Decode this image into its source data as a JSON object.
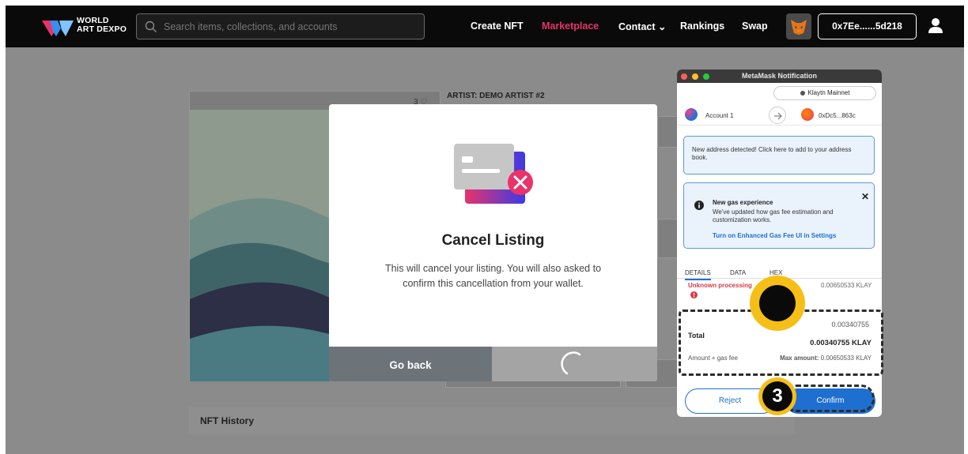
{
  "header": {
    "brand_line1": "WORLD",
    "brand_line2": "ART DEXPO",
    "search_placeholder": "Search items, collections, and accounts",
    "nav": {
      "create": "Create NFT",
      "marketplace": "Marketplace",
      "contact": "Contact ⌄",
      "rankings": "Rankings",
      "swap": "Swap"
    },
    "wallet_address": "0x7Ee......5d218",
    "active_color": "#e8336b"
  },
  "nft": {
    "like_count": "3 ♡",
    "artist": "ARTIST: DEMO ARTIST #2",
    "history_title": "NFT History"
  },
  "modal": {
    "title": "Cancel Listing",
    "body": "This will cancel your listing. You will also asked to confirm this cancellation from your wallet.",
    "back_label": "Go back"
  },
  "metamask": {
    "window_title": "MetaMask Notification",
    "network": "Klaytn Mainnet",
    "from_account": "Account 1",
    "to_address": "0xDc5...863c",
    "address_notice": "New address detected! Click here to add to your address book.",
    "gas_title": "New gas experience",
    "gas_text": "We've updated how gas fee estimation and customization works.",
    "gas_link": "Turn on Enhanced Gas Fee UI in Settings",
    "tabs": [
      "DETAILS",
      "DATA",
      "HEX"
    ],
    "processing_label": "Unknown processing",
    "gas_value": "0.00650533 KLAY",
    "total_label": "Total",
    "total_small": "0.00340755",
    "total_big": "0.00340755 KLAY",
    "amount_gas_label": "Amount + gas fee",
    "max_amount_label": "Max amount:",
    "max_amount_value": "0.00650533 KLAY",
    "reject_label": "Reject",
    "confirm_label": "Confirm",
    "accent_color": "#1f6fd0"
  },
  "tutorial": {
    "step_number": "3",
    "highlight_color": "#f6bf17"
  }
}
